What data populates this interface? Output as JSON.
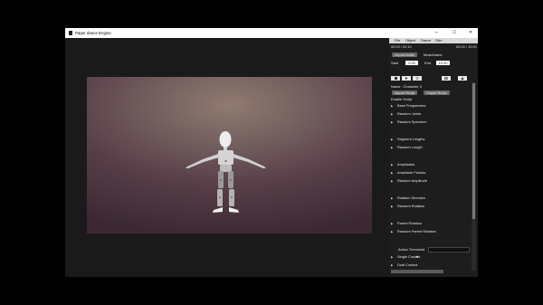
{
  "window": {
    "title": "Paper dance Engine",
    "controls": {
      "minimize": "–",
      "maximize": "☐",
      "close": "✕"
    }
  },
  "menu": [
    "File",
    "Object",
    "Dance",
    "Skin"
  ],
  "timeline": {
    "current": "00:00 / 00:10",
    "total": "00:00 / 10:00"
  },
  "audio": {
    "import_label": "Import Audio",
    "music_name": "MusicName"
  },
  "range": {
    "start_label": "Start",
    "start_value": "0.00",
    "end_label": "End",
    "end_value": "10.00"
  },
  "toolbar_icons": [
    "stop-icon",
    "play-icon",
    "refresh-icon",
    "grid-icon",
    "character-icon"
  ],
  "character": {
    "name_label": "Name : Character 0"
  },
  "script": {
    "import_label": "Import Script",
    "export_label": "Export Script",
    "enable_label": "Enable Script"
  },
  "params": [
    {
      "label": "Base Frequencies",
      "kind": "group"
    },
    {
      "label": "Random Joints",
      "kind": "group"
    },
    {
      "label": "Random Spectrum",
      "kind": "toggle"
    },
    {
      "label": "Segment Lengths",
      "kind": "group"
    },
    {
      "label": "Random Length",
      "kind": "toggle"
    },
    {
      "label": "Amplitudes",
      "kind": "group"
    },
    {
      "label": "Amplitude Factors",
      "kind": "group"
    },
    {
      "label": "Random Amplitude",
      "kind": "toggle"
    },
    {
      "label": "Rotation Direction",
      "kind": "group"
    },
    {
      "label": "Random Rotation",
      "kind": "toggle"
    },
    {
      "label": "Parent Rotation",
      "kind": "group"
    },
    {
      "label": "Random Parent Rotation",
      "kind": "toggle"
    }
  ],
  "action_threshold": {
    "label": "Action Threshold",
    "value": 0
  },
  "contact": [
    {
      "label": "Single Contact",
      "checked": true
    },
    {
      "label": "Dual Contact",
      "checked": false
    }
  ],
  "colors": {
    "accent": "#666666",
    "panel": "#1d1d1d",
    "stage_center": "#8f7b70",
    "stage_edge": "#3b2833"
  }
}
